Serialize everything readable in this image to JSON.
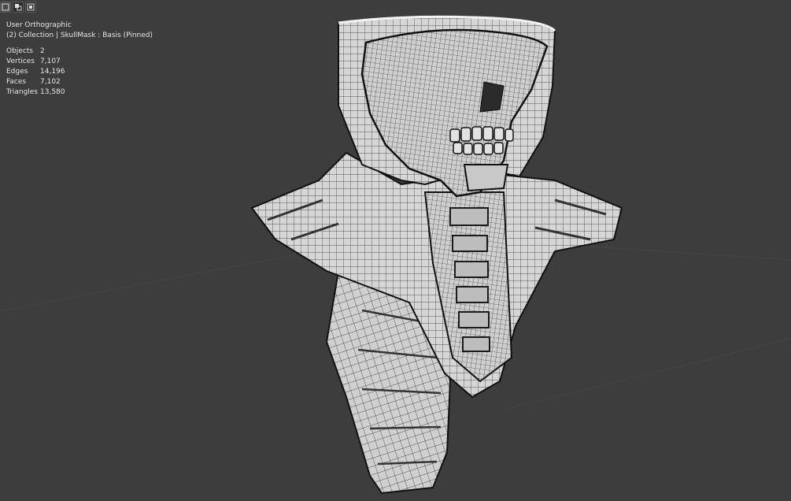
{
  "viewport": {
    "view_name": "User Orthographic",
    "collection": "(2) Collection | SkullMask : Basis (Pinned)",
    "stats": [
      {
        "label": "Objects",
        "value": "2"
      },
      {
        "label": "Vertices",
        "value": "7,107"
      },
      {
        "label": "Edges",
        "value": "14,196"
      },
      {
        "label": "Faces",
        "value": "7,102"
      },
      {
        "label": "Triangles",
        "value": "13,580"
      }
    ]
  },
  "toolbar": {
    "icons": [
      "select-box-icon",
      "select-extend-icon",
      "select-subtract-icon"
    ]
  },
  "colors": {
    "background": "#3d3d3d",
    "mesh_fill": "#d4d4d4",
    "wire": "#1a1a1a",
    "text": "#e6e6e6"
  }
}
